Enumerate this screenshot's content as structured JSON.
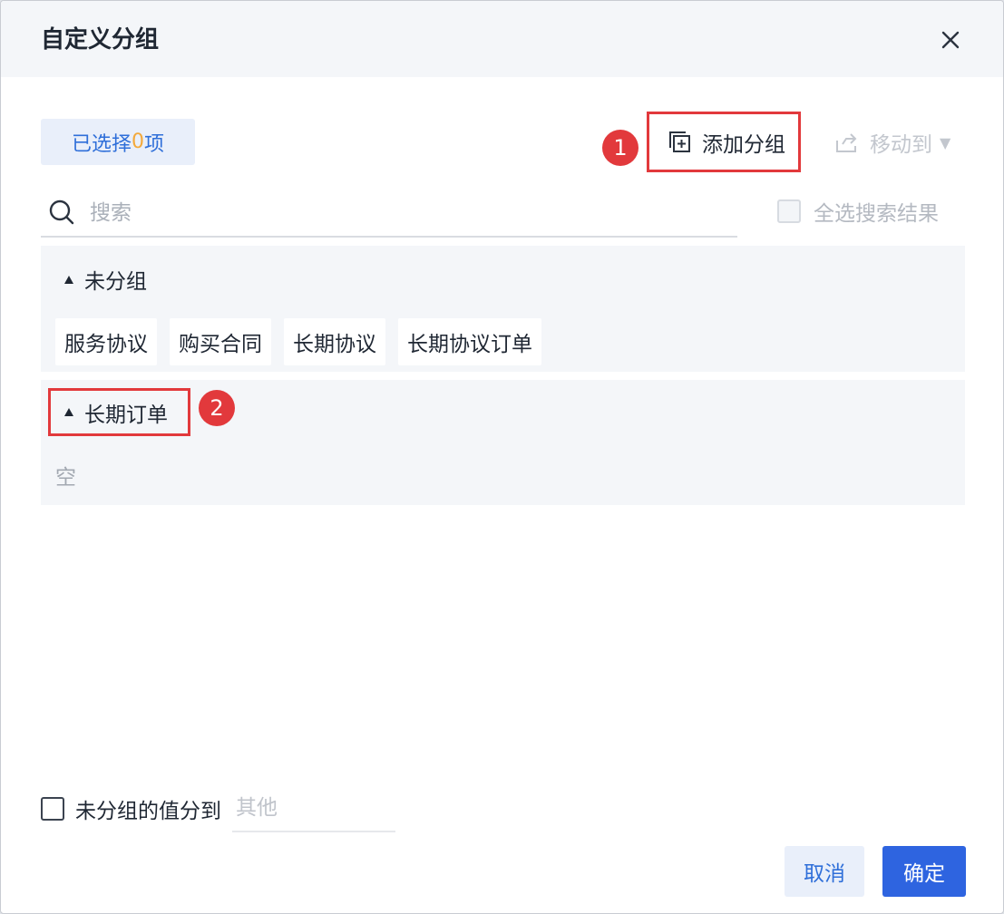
{
  "dialog": {
    "title": "自定义分组"
  },
  "toolbar": {
    "selected_prefix": "已选择",
    "selected_count": "0",
    "selected_suffix": "项",
    "add_group_label": "添加分组",
    "move_to_label": "移动到"
  },
  "annotations": {
    "badge1": "1",
    "badge2": "2"
  },
  "search": {
    "placeholder": "搜索",
    "select_all_label": "全选搜索结果"
  },
  "groups": [
    {
      "name": "未分组",
      "items": [
        "服务协议",
        "购买合同",
        "长期协议",
        "长期协议订单"
      ]
    },
    {
      "name": "长期订单",
      "empty_label": "空"
    }
  ],
  "footer": {
    "ungrouped_label": "未分组的值分到",
    "other_placeholder": "其他",
    "cancel_label": "取消",
    "ok_label": "确定"
  },
  "colors": {
    "accent": "#2e64e0",
    "highlight": "#e2393c",
    "count": "#f3a93b"
  }
}
